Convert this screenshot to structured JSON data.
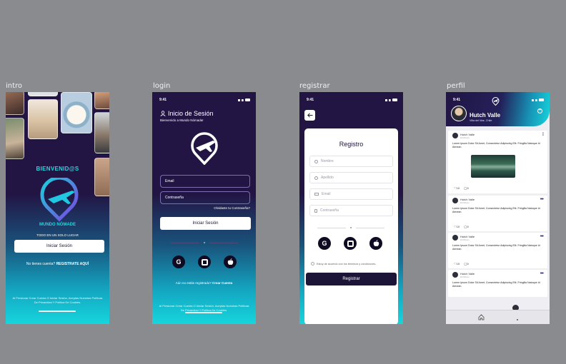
{
  "labels": {
    "intro": "intro",
    "login": "login",
    "registrar": "registrar",
    "perfil": "perfil"
  },
  "status": {
    "time": "9:41"
  },
  "intro": {
    "welcome": "BIENVENID@S",
    "brand": "MUNDO NÓMADE",
    "tagline": "TODO EN UN SOLO LUGAR",
    "login_button": "Iniciar Sesión",
    "no_account": "No tienes cuenta?",
    "register_link": "REGISTRATE AQUÍ",
    "legal": "Al Presionar Crear Cuenta O Iniciar Sesión, Aceptas Nuestras Politicas De Privacidad Y Politica De Cookies."
  },
  "login": {
    "title": "Inicio de Sesión",
    "subtitle": "Bienvenido a Mundo Nómada!",
    "email_placeholder": "Email",
    "password_placeholder": "Contraseña",
    "forgot": "Olvidaste tu Contraseña?",
    "login_button": "Iniciar Sesión",
    "or": "o",
    "no_account": "Aún no estás registrado?",
    "create_link": "Crear Cuenta",
    "legal": "Al Presionar Crear Cuenta O Iniciar Sesión, Aceptas Nuestras Politicas De Privacidad Y Politica De Cookies."
  },
  "registrar": {
    "back_icon": "arrow-left-icon",
    "title": "Registro",
    "fields": [
      "Nombre",
      "Apellido",
      "Email",
      "Contraseña"
    ],
    "or": "o",
    "terms": "Estoy de acuerdo con los términos y condiciones.",
    "register_button": "Registrar"
  },
  "social": {
    "google": "G",
    "facebook": "f",
    "apple": "apple-icon"
  },
  "perfil": {
    "name": "Hutch Valle",
    "location": "Villa del Mar, Chile",
    "posts": [
      {
        "author": "Hutch Valle",
        "time": "10:00 am",
        "text": "Lorem Ipsum Dolor Sit Amet, Consectetur Adipiscing Elit. Fringilla Natoque Id Aenean.",
        "likes": "10",
        "comments": "0",
        "has_image": true
      },
      {
        "author": "Hutch Valle",
        "time": "10:00 am",
        "text": "Lorem Ipsum Dolor Sit Amet, Consectetur Adipiscing Elit. Fringilla Natoque Id Aenean.",
        "likes": "10",
        "comments": "0",
        "has_image": false
      },
      {
        "author": "Hutch Valle",
        "time": "10:00 am",
        "text": "Lorem Ipsum Dolor Sit Amet, Consectetur Adipiscing Elit. Fringilla Natoque Id Aenean.",
        "likes": "10",
        "comments": "0",
        "has_image": false
      },
      {
        "author": "Hutch Valle",
        "time": "10:00 am",
        "text": "Lorem Ipsum Dolor Sit Amet, Consectetur Adipiscing Elit. Fringilla Natoque Id Aenean.",
        "likes": "",
        "comments": "",
        "has_image": false
      }
    ]
  },
  "colors": {
    "dark": "#221544",
    "accent": "#16d5dc",
    "button_dark": "#1d1538"
  }
}
